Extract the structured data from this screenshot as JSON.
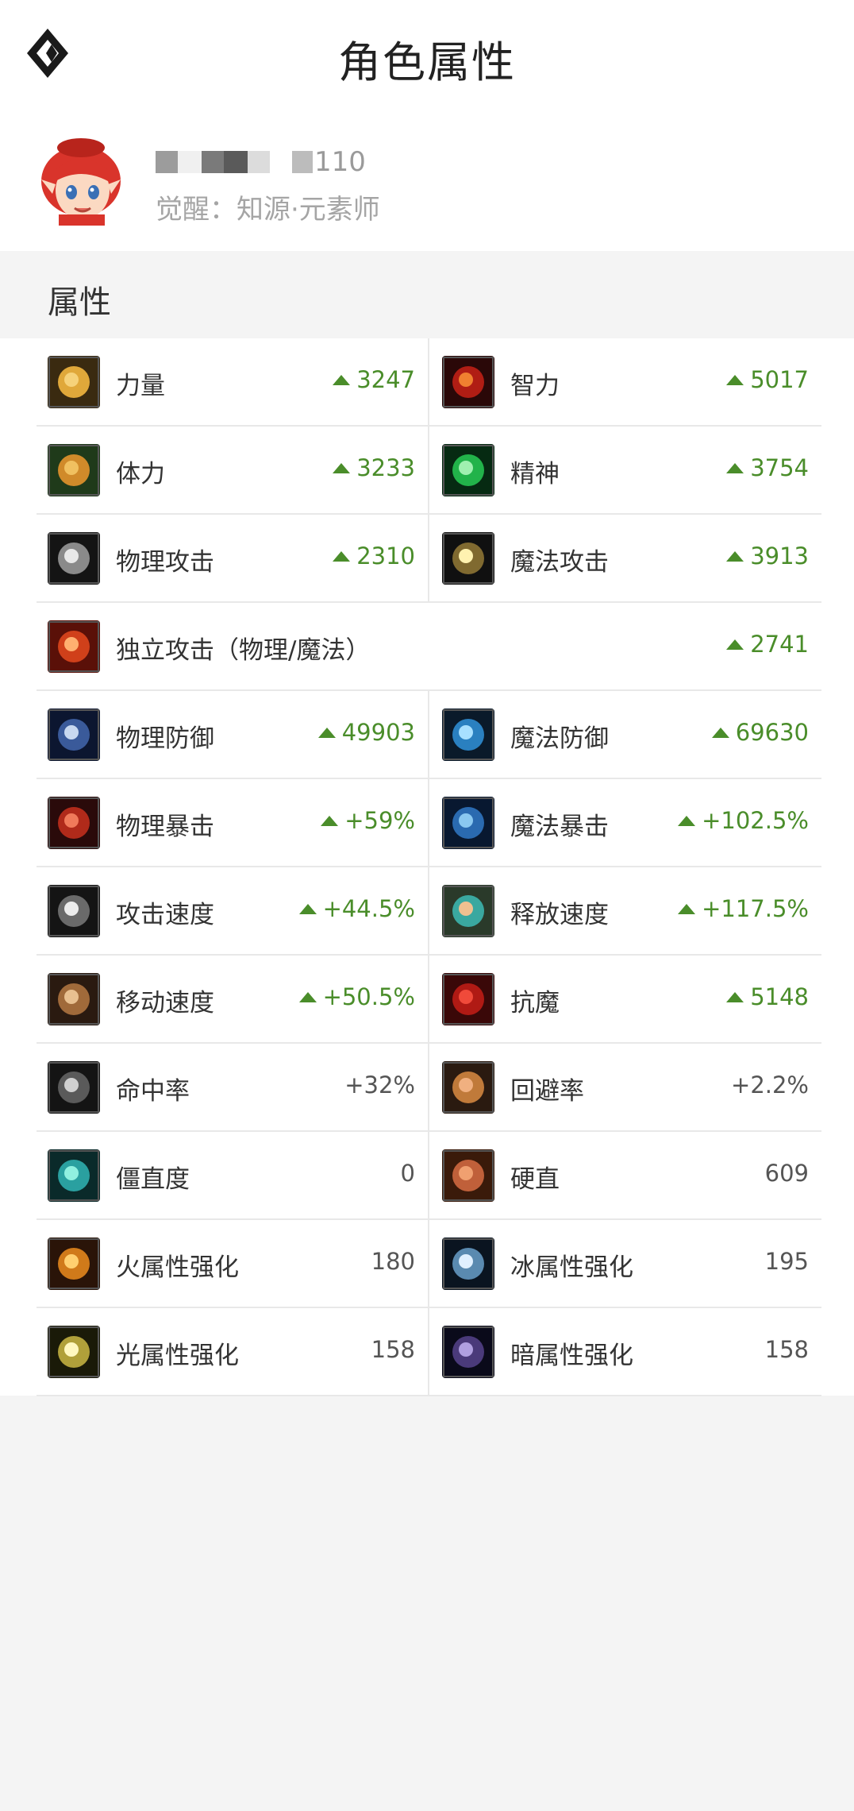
{
  "header": {
    "title": "角色属性"
  },
  "profile": {
    "level_suffix": "110",
    "class_text": "觉醒：知源·元素师"
  },
  "section": {
    "title": "属性"
  },
  "rows": [
    {
      "left": {
        "label": "力量",
        "value": "3247",
        "up": true,
        "icon": "strength-icon"
      },
      "right": {
        "label": "智力",
        "value": "5017",
        "up": true,
        "icon": "intelligence-icon"
      }
    },
    {
      "left": {
        "label": "体力",
        "value": "3233",
        "up": true,
        "icon": "vitality-icon"
      },
      "right": {
        "label": "精神",
        "value": "3754",
        "up": true,
        "icon": "spirit-icon"
      }
    },
    {
      "left": {
        "label": "物理攻击",
        "value": "2310",
        "up": true,
        "icon": "physical-attack-icon"
      },
      "right": {
        "label": "魔法攻击",
        "value": "3913",
        "up": true,
        "icon": "magic-attack-icon"
      }
    },
    {
      "full": {
        "label": "独立攻击（物理/魔法）",
        "value": "2741",
        "up": true,
        "icon": "independent-attack-icon"
      }
    },
    {
      "left": {
        "label": "物理防御",
        "value": "49903",
        "up": true,
        "icon": "physical-defense-icon"
      },
      "right": {
        "label": "魔法防御",
        "value": "69630",
        "up": true,
        "icon": "magic-defense-icon"
      }
    },
    {
      "left": {
        "label": "物理暴击",
        "value": "+59%",
        "up": true,
        "icon": "physical-crit-icon"
      },
      "right": {
        "label": "魔法暴击",
        "value": "+102.5%",
        "up": true,
        "icon": "magic-crit-icon"
      }
    },
    {
      "left": {
        "label": "攻击速度",
        "value": "+44.5%",
        "up": true,
        "icon": "attack-speed-icon"
      },
      "right": {
        "label": "释放速度",
        "value": "+117.5%",
        "up": true,
        "icon": "cast-speed-icon"
      }
    },
    {
      "left": {
        "label": "移动速度",
        "value": "+50.5%",
        "up": true,
        "icon": "move-speed-icon"
      },
      "right": {
        "label": "抗魔",
        "value": "5148",
        "up": true,
        "icon": "magic-resist-icon"
      }
    },
    {
      "left": {
        "label": "命中率",
        "value": "+32%",
        "up": false,
        "icon": "hit-rate-icon"
      },
      "right": {
        "label": "回避率",
        "value": "+2.2%",
        "up": false,
        "icon": "evasion-icon"
      }
    },
    {
      "left": {
        "label": "僵直度",
        "value": "0",
        "up": false,
        "icon": "stagger-icon"
      },
      "right": {
        "label": "硬直",
        "value": "609",
        "up": false,
        "icon": "hit-stun-icon"
      }
    },
    {
      "left": {
        "label": "火属性强化",
        "value": "180",
        "up": false,
        "icon": "fire-element-icon"
      },
      "right": {
        "label": "冰属性强化",
        "value": "195",
        "up": false,
        "icon": "ice-element-icon"
      }
    },
    {
      "left": {
        "label": "光属性强化",
        "value": "158",
        "up": false,
        "icon": "light-element-icon"
      },
      "right": {
        "label": "暗属性强化",
        "value": "158",
        "up": false,
        "icon": "dark-element-icon"
      }
    }
  ],
  "colors": {
    "up_green": "#4a8d2a",
    "divider": "#e8e8e8",
    "bg": "#f4f4f4"
  }
}
